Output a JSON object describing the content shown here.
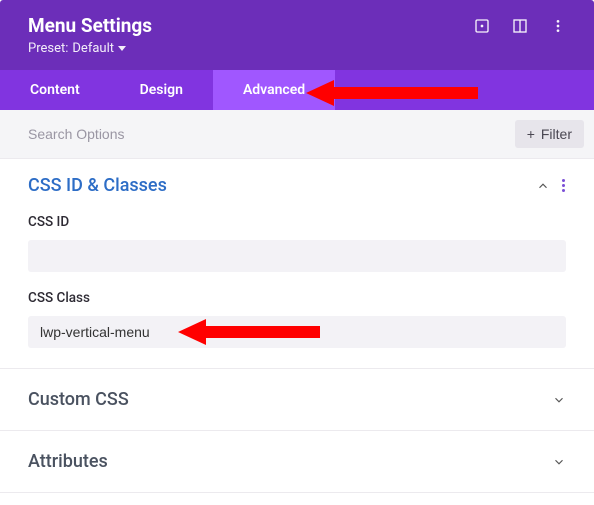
{
  "header": {
    "title": "Menu Settings",
    "preset_prefix": "Preset: ",
    "preset_value": "Default"
  },
  "tabs": {
    "content": "Content",
    "design": "Design",
    "advanced": "Advanced",
    "active": "advanced"
  },
  "search": {
    "placeholder": "Search Options",
    "filter_label": "Filter"
  },
  "sections": {
    "css_id_classes": {
      "title": "CSS ID & Classes",
      "expanded": true,
      "fields": {
        "css_id": {
          "label": "CSS ID",
          "value": ""
        },
        "css_class": {
          "label": "CSS Class",
          "value": "lwp-vertical-menu"
        }
      }
    },
    "custom_css": {
      "title": "Custom CSS",
      "expanded": false
    },
    "attributes": {
      "title": "Attributes",
      "expanded": false
    }
  }
}
